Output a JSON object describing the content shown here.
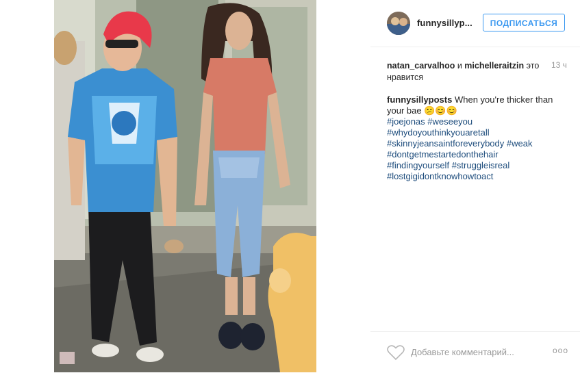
{
  "post": {
    "username": "funnysillyp...",
    "follow_label": "ПОДПИСАТЬСЯ",
    "likes": {
      "user1": "natan_carvalhoo",
      "conj": "и",
      "user2": "michelleraitzin",
      "tail": "это нравится"
    },
    "time": "13 ч",
    "caption": {
      "user": "funnysillyposts",
      "text": "When you're thicker than your bae 😕😊😊",
      "tags_line1": "#joejonas",
      "tags_line1b": "#weseeyou",
      "tag_line2": "#whydoyouthinkyouaretall",
      "tag_line3a": "#skinnyjeansaintforeverybody",
      "tag_line3b": "#weak",
      "tag_line4": "#dontgetmestartedonthehair",
      "tag_line5a": "#findingyourself",
      "tag_line5b": "#struggleisreal",
      "tag_line6": "#lostgigidontknowhowtoact"
    },
    "comment_placeholder": "Добавьте комментарий...",
    "more_label": "ooo"
  },
  "icons": {
    "heart": "heart-icon",
    "more": "more-options-icon"
  }
}
